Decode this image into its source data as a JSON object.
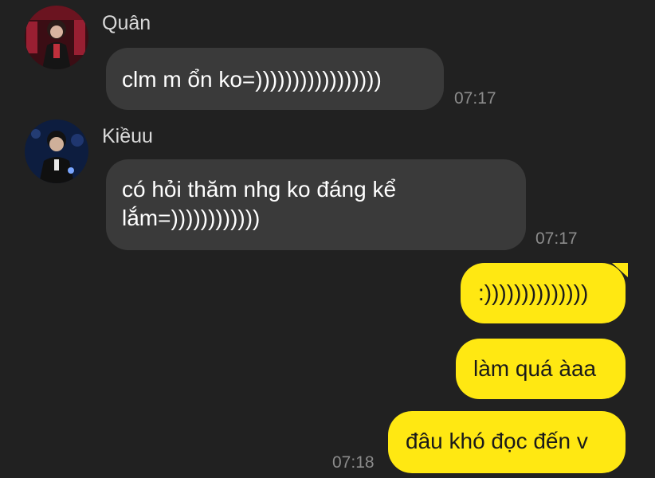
{
  "messages": [
    {
      "sender": "Quân",
      "text": "clm m ổn ko=)))))))))))))))))",
      "time": "07:17"
    },
    {
      "sender": "Kiềuu",
      "text": "có hỏi thăm nhg ko đáng kể lắm=))))))))))))",
      "time": "07:17"
    },
    {
      "text": ":))))))))))))))"
    },
    {
      "text": "làm quá àaa"
    },
    {
      "text": "đâu khó đọc đến v",
      "time": "07:18"
    }
  ],
  "colors": {
    "background": "#212121",
    "incoming_bubble": "#3a3a3a",
    "outgoing_bubble": "#ffe812"
  },
  "icons": {
    "avatar_1": "avatar-photo-quan",
    "avatar_2": "avatar-photo-kieuu"
  }
}
